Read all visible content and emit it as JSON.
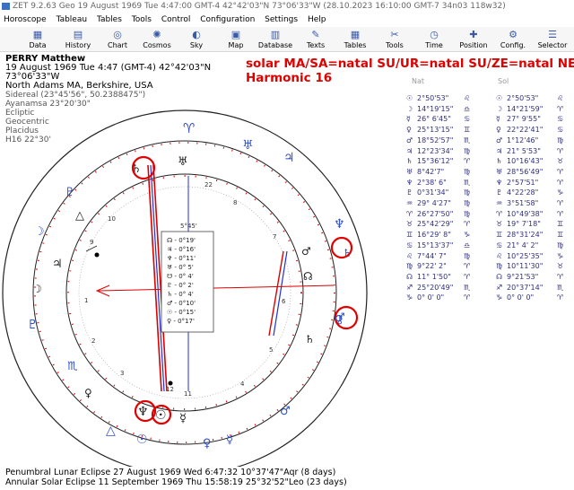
{
  "window": {
    "title": "ZET 9.2.63 Geo    19 August 1969   Tue    4:47:00 GMT-4 42°42'03\"N  73°06'33\"W    (28.10.2023    16:10:00 GMT-7 34n03 118w32)"
  },
  "menu": [
    "Horoscope",
    "Tableau",
    "Tables",
    "Tools",
    "Control",
    "Configuration",
    "Settings",
    "Help"
  ],
  "toolbar": [
    {
      "label": "Data",
      "icon": "data-icon"
    },
    {
      "label": "History",
      "icon": "history-icon"
    },
    {
      "label": "Chart",
      "icon": "chart-icon"
    },
    {
      "label": "Cosmos",
      "icon": "cosmos-icon"
    },
    {
      "label": "Sky",
      "icon": "sky-icon"
    },
    {
      "label": "Map",
      "icon": "map-icon"
    },
    {
      "label": "Database",
      "icon": "database-icon"
    },
    {
      "label": "Texts",
      "icon": "texts-icon"
    },
    {
      "label": "Tables",
      "icon": "tables-icon"
    },
    {
      "label": "Tools",
      "icon": "tools-icon"
    },
    {
      "label": "Time",
      "icon": "time-icon"
    },
    {
      "label": "Position",
      "icon": "position-icon"
    },
    {
      "label": "Config.",
      "icon": "config-icon"
    },
    {
      "label": "Selector",
      "icon": "selector-icon"
    }
  ],
  "chart_info": {
    "name": "PERRY Matthew",
    "datetime": "19 August 1969   Tue    4:47 (GMT-4) 42°42'03\"N  73°06'33\"W",
    "place": "North Adams MA, Berkshire, USA",
    "sidereal": "Sidereal (23°45'56\", 50.2388475\")",
    "ayanamsa": "Ayanamsa 23°20'30\"",
    "ecliptic": "Ecliptic",
    "geocentric": "Geocentric",
    "houses": "Placidus",
    "harmonic_line": "H16   22°30'"
  },
  "annotation": {
    "line1": "solar MA/SA=natal SU/UR=natal SU/ZE=natal NE/ZE",
    "line2": "Harmonic 16"
  },
  "colors": {
    "annotation": "#e00000",
    "glyph_blue": "#2f4fc8",
    "glyph_dark": "#202020",
    "circle_mark": "#e00000"
  },
  "chart_center": {
    "degree_label": "5°45'",
    "aspect_rows": [
      "☊ - 0°19'",
      "♃ - 0°16'",
      "♆ - 0°11'",
      "♅ - 0° 5'",
      "☋ - 0° 4'",
      "♇ - 0° 2'",
      "♄ - 0° 4'",
      "♂ - 0°10'",
      "☉ - 0°15'",
      "♀ - 0°17'"
    ]
  },
  "house_numbers": [
    "22",
    "11",
    "12",
    "1",
    "2",
    "3",
    "4",
    "5",
    "6",
    "7",
    "8",
    "9",
    "10"
  ],
  "table": {
    "col_natal_header": "Nat",
    "col_solar_header": "Sol",
    "rows": [
      {
        "p": "☉",
        "n": "2°50'53\"",
        "s1": "♌",
        "q": "☉",
        "v": "2°50'53\"",
        "s2": "♌"
      },
      {
        "p": "☽",
        "n": "14°19'15\"",
        "s1": "♎",
        "q": "☽",
        "v": "14°21'59\"",
        "s2": "♈"
      },
      {
        "p": "☿",
        "n": "26° 6'45\"",
        "s1": "♋",
        "q": "☿",
        "v": "27° 9'55\"",
        "s2": "♋"
      },
      {
        "p": "♀",
        "n": "25°13'15\"",
        "s1": "♊",
        "q": "♀",
        "v": "22°22'41\"",
        "s2": "♋"
      },
      {
        "p": "♂",
        "n": "18°52'57\"",
        "s1": "♏",
        "q": "♂",
        "v": "1°12'46\"",
        "s2": "♍"
      },
      {
        "p": "♃",
        "n": "12°23'34\"",
        "s1": "♍",
        "q": "♃",
        "v": "21° 5'53\"",
        "s2": "♈"
      },
      {
        "p": "♄",
        "n": "15°36'12\"",
        "s1": "♈",
        "q": "♄",
        "v": "10°16'43\"",
        "s2": "♉"
      },
      {
        "p": "♅",
        "n": "8°42'7\"",
        "s1": "♍",
        "q": "♅",
        "v": "28°56'49\"",
        "s2": "♈"
      },
      {
        "p": "♆",
        "n": "2°38' 6\"",
        "s1": "♏",
        "q": "♆",
        "v": "2°57'51\"",
        "s2": "♈"
      },
      {
        "p": "♇",
        "n": "0°31'34\"",
        "s1": "♍",
        "q": "♇",
        "v": "4°22'28\"",
        "s2": "♑"
      },
      {
        "p": "♒",
        "n": "29° 4'27\"",
        "s1": "♍",
        "q": "♒",
        "v": "3°51'58\"",
        "s2": "♈"
      },
      {
        "p": "♈",
        "n": "26°27'50\"",
        "s1": "♍",
        "q": "♈",
        "v": "10°49'38\"",
        "s2": "♈"
      },
      {
        "p": "♉",
        "n": "25°42'29\"",
        "s1": "♈",
        "q": "♉",
        "v": "19° 7'18\"",
        "s2": "♊"
      },
      {
        "p": "♊",
        "n": "16°29' 8\"",
        "s1": "♑",
        "q": "♊",
        "v": "28°31'24\"",
        "s2": "♊"
      },
      {
        "p": "♋",
        "n": "15°13'37\"",
        "s1": "♎",
        "q": "♋",
        "v": "21° 4' 2\"",
        "s2": "♍"
      },
      {
        "p": "♌",
        "n": "7°44' 7\"",
        "s1": "♍",
        "q": "♌",
        "v": "10°25'35\"",
        "s2": "♑"
      },
      {
        "p": "♍",
        "n": "9°22' 2\"",
        "s1": "♈",
        "q": "♍",
        "v": "10°11'30\"",
        "s2": "♉"
      },
      {
        "p": "☊",
        "n": "11° 1'50\"",
        "s1": "♈",
        "q": "☊",
        "v": "9°21'53\"",
        "s2": "♈"
      },
      {
        "p": "♐",
        "n": "25°20'49\"",
        "s1": "♏",
        "q": "♐",
        "v": "20°37'14\"",
        "s2": "♏"
      },
      {
        "p": "♑",
        "n": "0° 0' 0\"",
        "s1": "♈",
        "q": "♑",
        "v": "0° 0' 0\"",
        "s2": "♈"
      }
    ]
  },
  "footer": {
    "line1": "Penumbral Lunar Eclipse 27 August 1969 Wed  6:47:32 10°37'47\"Aqr (8 days)",
    "line2": "Annular Solar Eclipse 11 September 1969 Thu 15:58:19 25°32'52\"Leo (23 days)"
  }
}
